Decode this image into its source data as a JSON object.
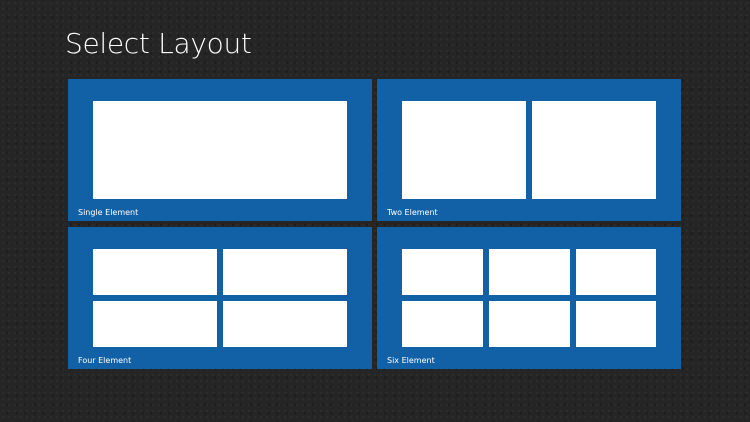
{
  "page": {
    "title": "Select Layout"
  },
  "colors": {
    "background": "#252525",
    "tile": "#1261a6",
    "preview": "#ffffff",
    "text": "#ffffff"
  },
  "layouts": [
    {
      "label": "Single Element",
      "element_count": 1
    },
    {
      "label": "Two Element",
      "element_count": 2
    },
    {
      "label": "Four Element",
      "element_count": 4
    },
    {
      "label": "Six Element",
      "element_count": 6
    }
  ]
}
